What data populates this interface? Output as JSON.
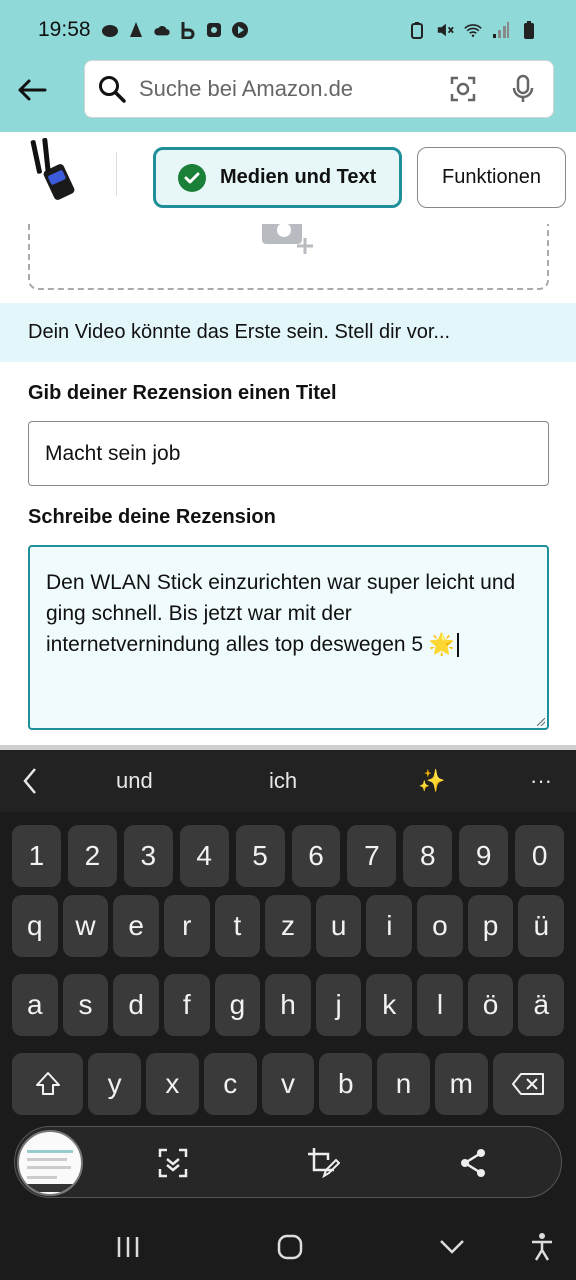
{
  "status_bar": {
    "time": "19:58",
    "left_icons": [
      "cloud-game-icon",
      "cone-icon",
      "cloud-icon",
      "b-icon",
      "square-app-icon",
      "play-icon"
    ],
    "right_icons": [
      "lock-battery-icon",
      "mute-icon",
      "wifi-icon",
      "signal-icon",
      "battery-icon"
    ]
  },
  "header": {
    "search_placeholder": "Suche bei Amazon.de"
  },
  "tabs": {
    "media_text": "Medien und Text",
    "functions": "Funktionen"
  },
  "banner": {
    "text": "Dein Video könnte das Erste sein. Stell dir vor..."
  },
  "review_form": {
    "title_label": "Gib deiner Rezension einen Titel",
    "title_value": "Macht sein job",
    "review_label": "Schreibe deine Rezension",
    "review_value": "Den WLAN Stick einzurichten war super leicht und ging schnell. Bis jetzt war mit der internetvernindung alles top deswegen 5 🌟"
  },
  "keyboard": {
    "suggestions": [
      "und",
      "ich",
      "✨"
    ],
    "more": "···",
    "rows": [
      [
        "1",
        "2",
        "3",
        "4",
        "5",
        "6",
        "7",
        "8",
        "9",
        "0"
      ],
      [
        "q",
        "w",
        "e",
        "r",
        "t",
        "z",
        "u",
        "i",
        "o",
        "p",
        "ü"
      ],
      [
        "a",
        "s",
        "d",
        "f",
        "g",
        "h",
        "j",
        "k",
        "l",
        "ö",
        "ä"
      ],
      [
        "y",
        "x",
        "c",
        "v",
        "b",
        "n",
        "m"
      ]
    ]
  },
  "colors": {
    "header_bg": "#8fd9d9",
    "accent": "#1f8f99",
    "banner_bg": "#e3f6fa",
    "keyboard_bg": "#1b1b1b",
    "key_bg": "#3a3a3a"
  }
}
